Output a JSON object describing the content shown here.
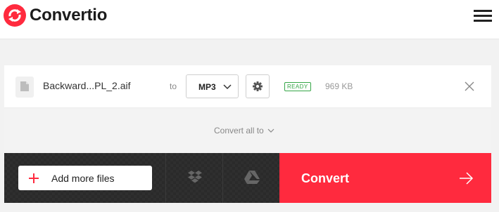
{
  "header": {
    "brand_name": "Convertio",
    "brand_color": "#ff2a3e",
    "logo_icon": "convertio-logo-icon",
    "menu_icon": "hamburger-menu-icon"
  },
  "file": {
    "name": "Backward...PL_2.aif",
    "to_label": "to",
    "target_format": "MP3",
    "status": "READY",
    "status_color": "#35a647",
    "size": "969 KB",
    "file_icon": "file-icon",
    "settings_icon": "gear-icon",
    "remove_icon": "close-icon"
  },
  "convert_all": {
    "label": "Convert all to",
    "icon": "chevron-down-icon"
  },
  "actions": {
    "add_files_label": "Add more files",
    "add_icon": "plus-icon",
    "dropbox_icon": "dropbox-icon",
    "drive_icon": "google-drive-icon",
    "convert_label": "Convert",
    "convert_icon": "arrow-right-icon",
    "convert_color": "#ff2a3e"
  }
}
